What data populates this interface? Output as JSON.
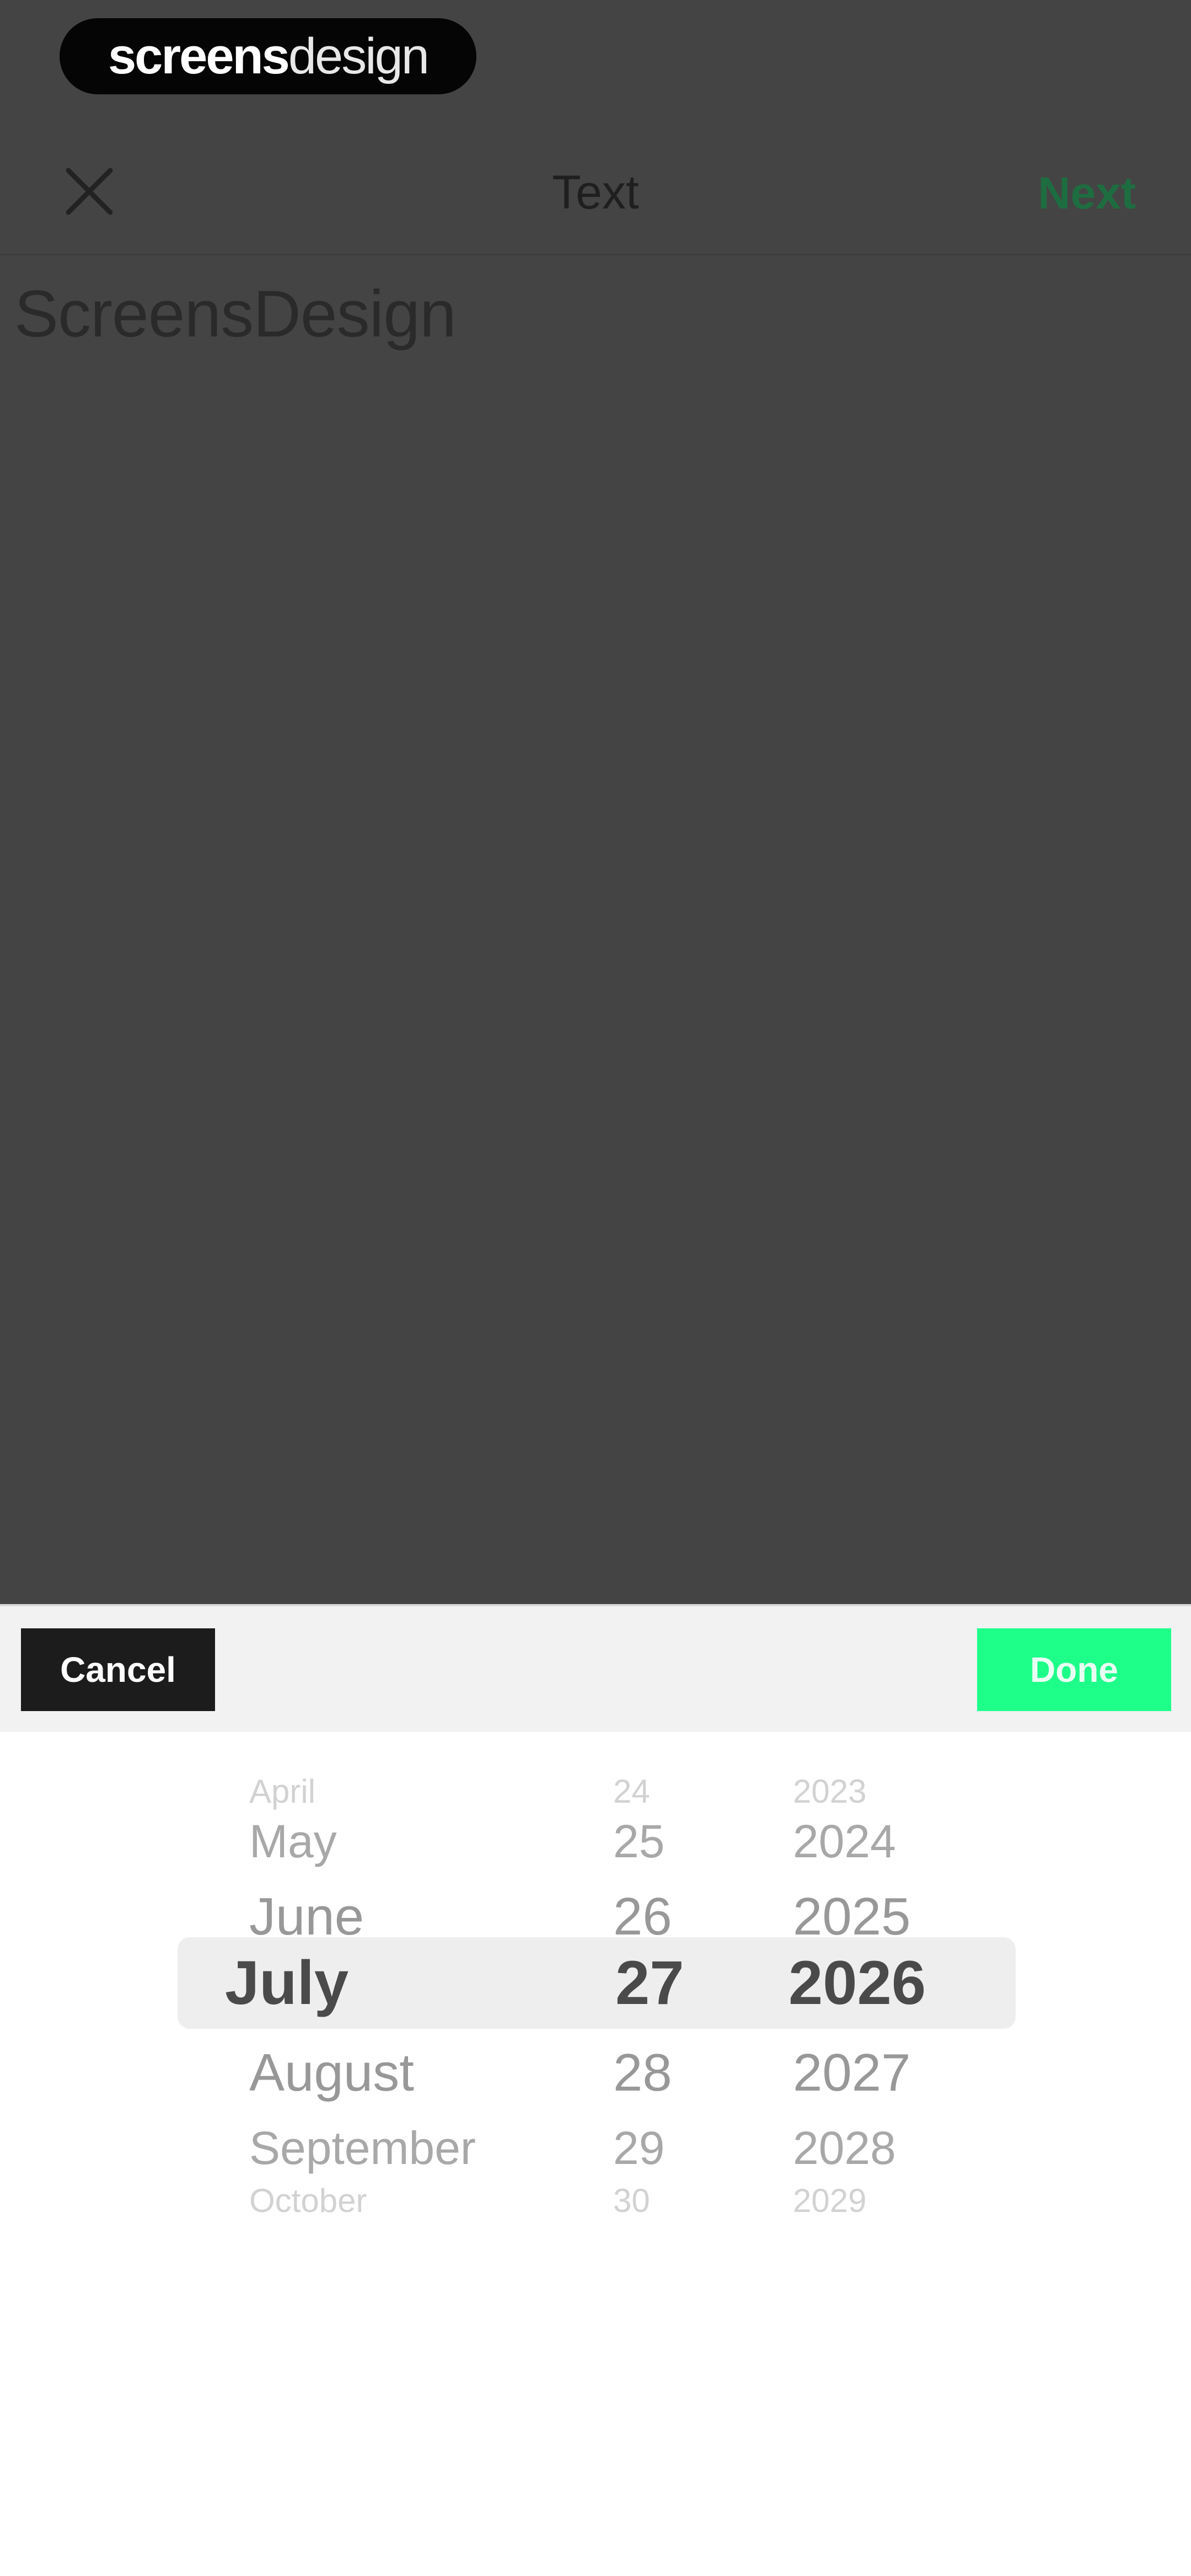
{
  "brand": {
    "bold": "screens",
    "light": "design"
  },
  "nav": {
    "title": "Text",
    "next_label": "Next"
  },
  "content": {
    "text": "ScreensDesign"
  },
  "picker": {
    "cancel_label": "Cancel",
    "done_label": "Done",
    "rows": [
      {
        "month": "April",
        "day": "24",
        "year": "2023"
      },
      {
        "month": "May",
        "day": "25",
        "year": "2024"
      },
      {
        "month": "June",
        "day": "26",
        "year": "2025"
      },
      {
        "month": "July",
        "day": "27",
        "year": "2026"
      },
      {
        "month": "August",
        "day": "28",
        "year": "2027"
      },
      {
        "month": "September",
        "day": "29",
        "year": "2028"
      },
      {
        "month": "October",
        "day": "30",
        "year": "2029"
      }
    ],
    "selected": {
      "month": "July",
      "day": "27",
      "year": "2026"
    }
  },
  "colors": {
    "overlay": "#444444",
    "accent_done": "#1eff8a",
    "cancel_bg": "#1c1c1c",
    "next_text": "#1e6d40"
  }
}
